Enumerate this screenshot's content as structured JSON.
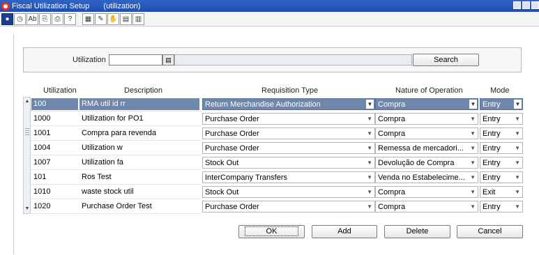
{
  "window": {
    "title": "Fiscal Utilization Setup",
    "subtitle": "(utilization)"
  },
  "toolbar": {
    "icons": [
      "exit-icon",
      "clock-icon",
      "spell-check-icon",
      "copy-icon",
      "print-icon",
      "help-icon",
      "grid-icon",
      "edit-icon",
      "hand-icon",
      "chart-icon",
      "report-icon"
    ],
    "glyphs": [
      "●",
      "◷",
      "Ab",
      "⎘",
      "⎙",
      "?",
      "▦",
      "✎",
      "✋",
      "▤",
      "▥"
    ]
  },
  "search": {
    "label": "Utilization",
    "value": "",
    "button": "Search"
  },
  "table": {
    "headers": {
      "utilization": "Utilization",
      "description": "Description",
      "requisition_type": "Requisition Type",
      "nature": "Nature of Operation",
      "mode": "Mode"
    },
    "rows": [
      {
        "utilization": "100",
        "description": "RMA util id rr",
        "requisition_type": "Return Merchandise Authorization",
        "nature": "Compra",
        "mode": "Entry"
      },
      {
        "utilization": "1000",
        "description": "Utilization for PO1",
        "requisition_type": "Purchase Order",
        "nature": "Compra",
        "mode": "Entry"
      },
      {
        "utilization": "1001",
        "description": "Compra para revenda",
        "requisition_type": "Purchase Order",
        "nature": "Compra",
        "mode": "Entry"
      },
      {
        "utilization": "1004",
        "description": "Utilization w",
        "requisition_type": "Purchase Order",
        "nature": "Remessa de mercadori...",
        "mode": "Entry"
      },
      {
        "utilization": "1007",
        "description": "Utilization fa",
        "requisition_type": "Stock Out",
        "nature": "Devolução de Compra",
        "mode": "Entry"
      },
      {
        "utilization": "101",
        "description": "Ros Test",
        "requisition_type": "InterCompany Transfers",
        "nature": "Venda no Estabelecime...",
        "mode": "Entry"
      },
      {
        "utilization": "1010",
        "description": "waste stock util",
        "requisition_type": "Stock Out",
        "nature": "Compra",
        "mode": "Exit"
      },
      {
        "utilization": "1020",
        "description": "Purchase Order Test",
        "requisition_type": "Purchase Order",
        "nature": "Compra",
        "mode": "Entry"
      }
    ]
  },
  "buttons": {
    "ok": "OK",
    "add": "Add",
    "delete": "Delete",
    "cancel": "Cancel"
  }
}
